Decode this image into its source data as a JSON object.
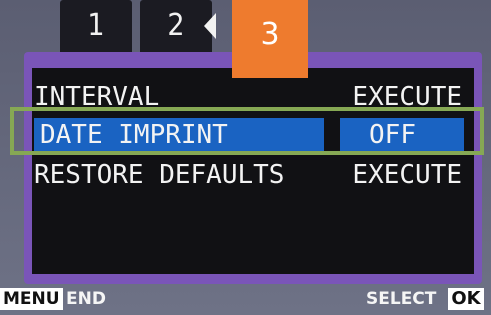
{
  "tabs": [
    {
      "label": "1"
    },
    {
      "label": "2"
    },
    {
      "label": "3",
      "active": true
    }
  ],
  "menu": {
    "items": [
      {
        "label": "INTERVAL",
        "value": "EXECUTE",
        "selected": false
      },
      {
        "label": "DATE IMPRINT",
        "value": "OFF",
        "selected": true
      },
      {
        "label": "RESTORE DEFAULTS",
        "value": "EXECUTE",
        "selected": false
      }
    ]
  },
  "footer": {
    "menu_key": "MENU",
    "menu_action": "END",
    "select_label": "SELECT",
    "ok_key": "OK"
  },
  "colors": {
    "active_tab": "#ee7b2e",
    "selection": "#1a63c2",
    "panel_border": "#7a55b8",
    "highlight_frame": "#86a854"
  }
}
